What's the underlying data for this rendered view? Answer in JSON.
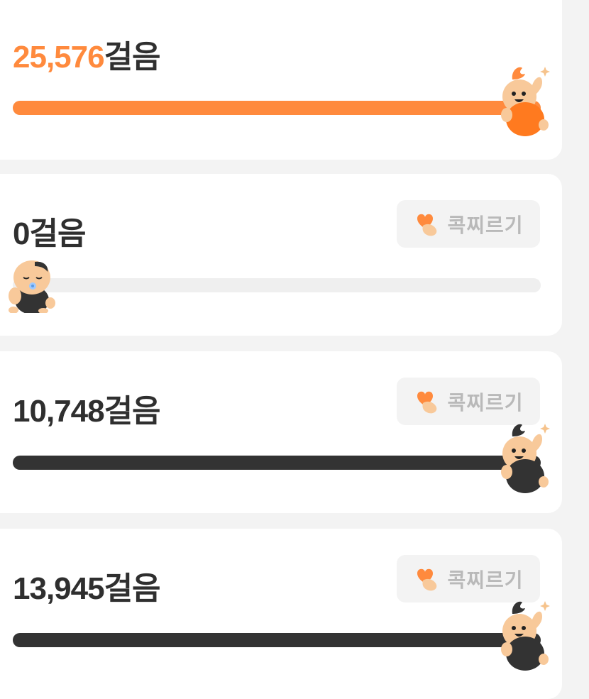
{
  "unit_label": "걸음",
  "poke_label": "콕찌르기",
  "colors": {
    "accent": "#ff8a3d",
    "dark": "#333333",
    "track": "#efefef"
  },
  "cards": [
    {
      "steps": "25,576",
      "highlight": true,
      "progress": 1.0,
      "fill_color": "#ff8a3d",
      "has_poke": false,
      "mascot": "cheering-orange"
    },
    {
      "steps": "0",
      "highlight": false,
      "progress": 0.0,
      "fill_color": "#333333",
      "has_poke": true,
      "mascot": "baby-pacifier"
    },
    {
      "steps": "10,748",
      "highlight": false,
      "progress": 1.0,
      "fill_color": "#333333",
      "has_poke": true,
      "mascot": "cheering-dark"
    },
    {
      "steps": "13,945",
      "highlight": false,
      "progress": 1.0,
      "fill_color": "#333333",
      "has_poke": true,
      "mascot": "cheering-dark"
    }
  ]
}
